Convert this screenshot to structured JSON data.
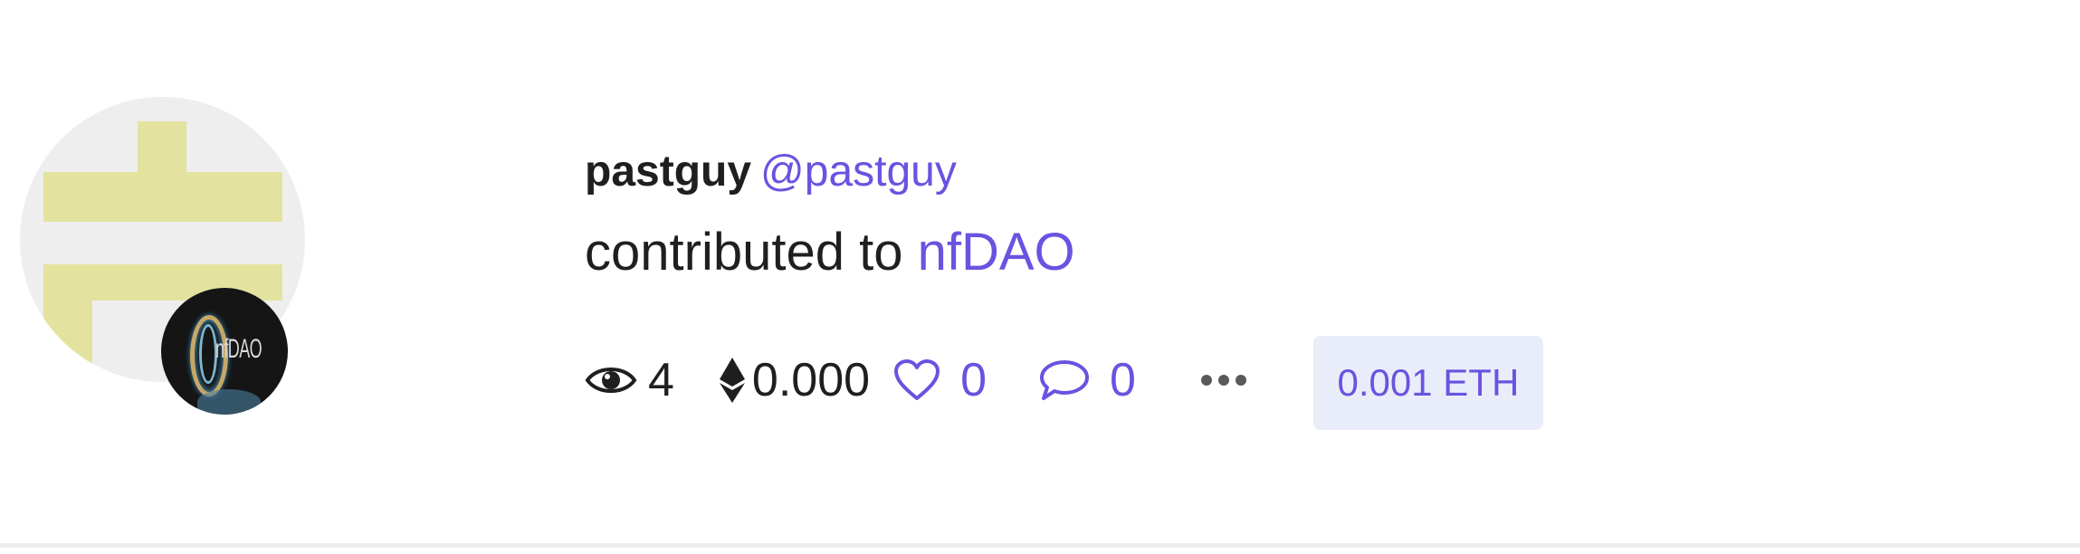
{
  "feed_item": {
    "user": {
      "display_name": "pastguy",
      "handle": "@pastguy"
    },
    "action": {
      "verb": "contributed to",
      "target": "nfDAO"
    },
    "badge": {
      "text": "nfDAO"
    },
    "stats": {
      "views": "4",
      "eth_amount": "0.000",
      "likes": "0",
      "comments": "0"
    },
    "price": "0.001 ETH"
  },
  "colors": {
    "accent": "#6b52e0",
    "text": "#1f1f1f",
    "price_bg": "#e9edf9",
    "avatar_bg": "#eeeeee",
    "avatar_pattern": "#e3e39f"
  },
  "icons": {
    "views": "eye-icon",
    "eth": "ethereum-icon",
    "likes": "heart-icon",
    "comments": "speech-bubble-icon",
    "more": "ellipsis-icon"
  }
}
